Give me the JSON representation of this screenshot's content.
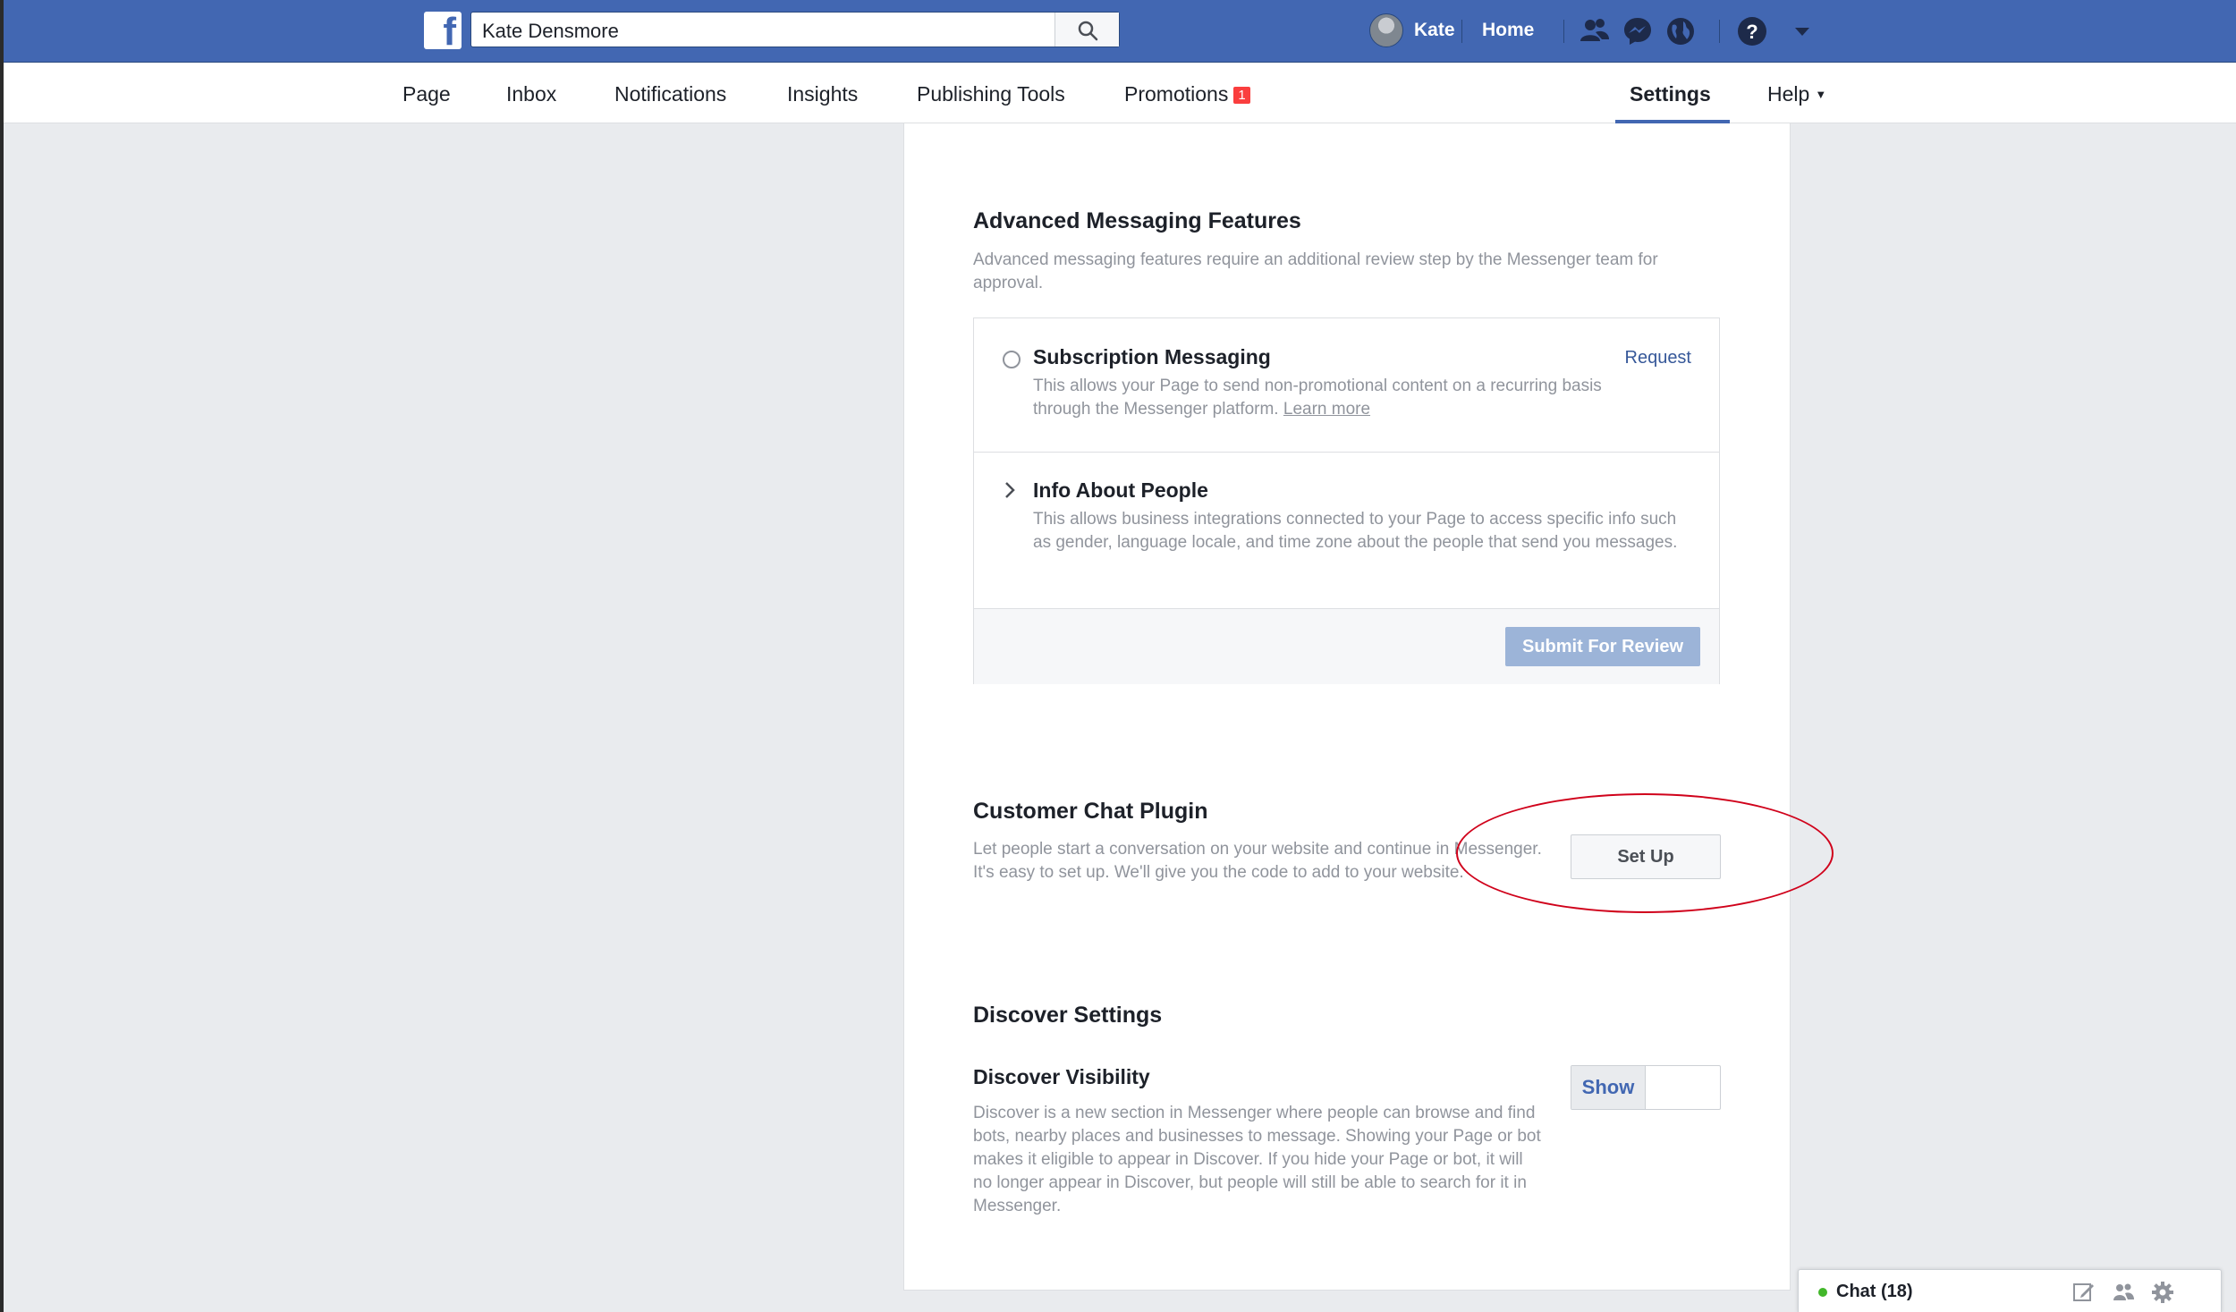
{
  "topbar": {
    "search_value": "Kate Densmore",
    "user_name": "Kate",
    "home_label": "Home"
  },
  "nav": {
    "page": "Page",
    "inbox": "Inbox",
    "notifications": "Notifications",
    "insights": "Insights",
    "publishing_tools": "Publishing Tools",
    "promotions": "Promotions",
    "promotions_badge": "1",
    "settings": "Settings",
    "help": "Help"
  },
  "advanced": {
    "title": "Advanced Messaging Features",
    "description": "Advanced messaging features require an additional review step by the Messenger team for approval.",
    "subscription": {
      "title": "Subscription Messaging",
      "description": "This allows your Page to send non-promotional content on a recurring basis through the Messenger platform.",
      "learn_more": "Learn more",
      "request": "Request"
    },
    "info_people": {
      "title": "Info About People",
      "description": "This allows business integrations connected to your Page to access specific info such as gender, language locale, and time zone about the people that send you messages."
    },
    "submit_label": "Submit For Review"
  },
  "chat_plugin": {
    "title": "Customer Chat Plugin",
    "description": "Let people start a conversation on your website and continue in Messenger. It's easy to set up. We'll give you the code to add to your website.",
    "setup_label": "Set Up"
  },
  "discover": {
    "title": "Discover Settings",
    "visibility_title": "Discover Visibility",
    "description": "Discover is a new section in Messenger where people can browse and find bots, nearby places and businesses to message. Showing your Page or bot makes it eligible to appear in Discover. If you hide your Page or bot, it will no longer appear in Discover, but people will still be able to search for it in Messenger.",
    "toggle_label": "Show"
  },
  "chat": {
    "label": "Chat (18)"
  },
  "colors": {
    "brand_blue": "#4267b2",
    "annotation_red": "#d0021b",
    "badge_red": "#fa3e3e",
    "online_green": "#42b72a"
  }
}
